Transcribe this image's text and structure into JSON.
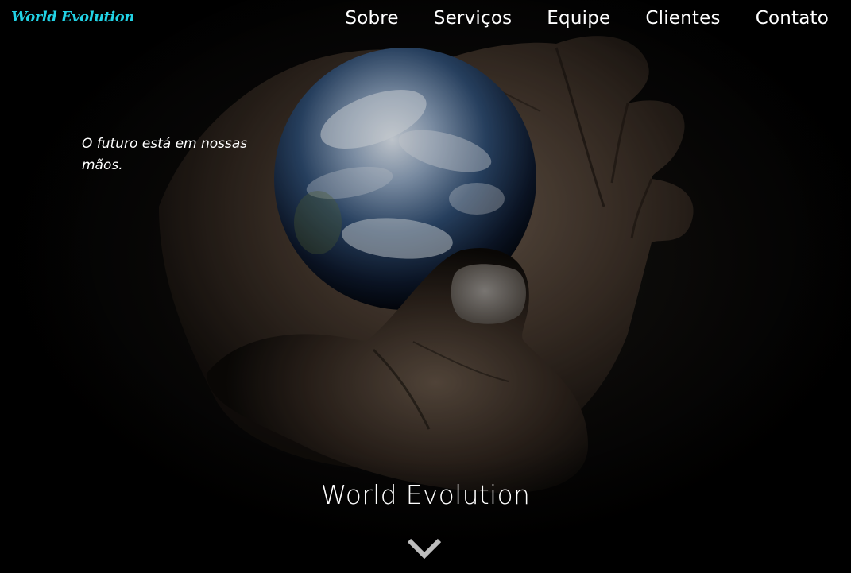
{
  "brand": {
    "name": "World Evolution"
  },
  "nav": {
    "items": [
      {
        "label": "Sobre"
      },
      {
        "label": "Serviços"
      },
      {
        "label": "Equipe"
      },
      {
        "label": "Clientes"
      },
      {
        "label": "Contato"
      }
    ]
  },
  "hero": {
    "tagline": "O futuro está em nossas mãos.",
    "title": "World Evolution",
    "scroll_icon": "chevron-down-icon"
  },
  "colors": {
    "brand": "#22d3e6",
    "text": "#ffffff",
    "background": "#000000",
    "chevron": "#bdbdbd"
  }
}
